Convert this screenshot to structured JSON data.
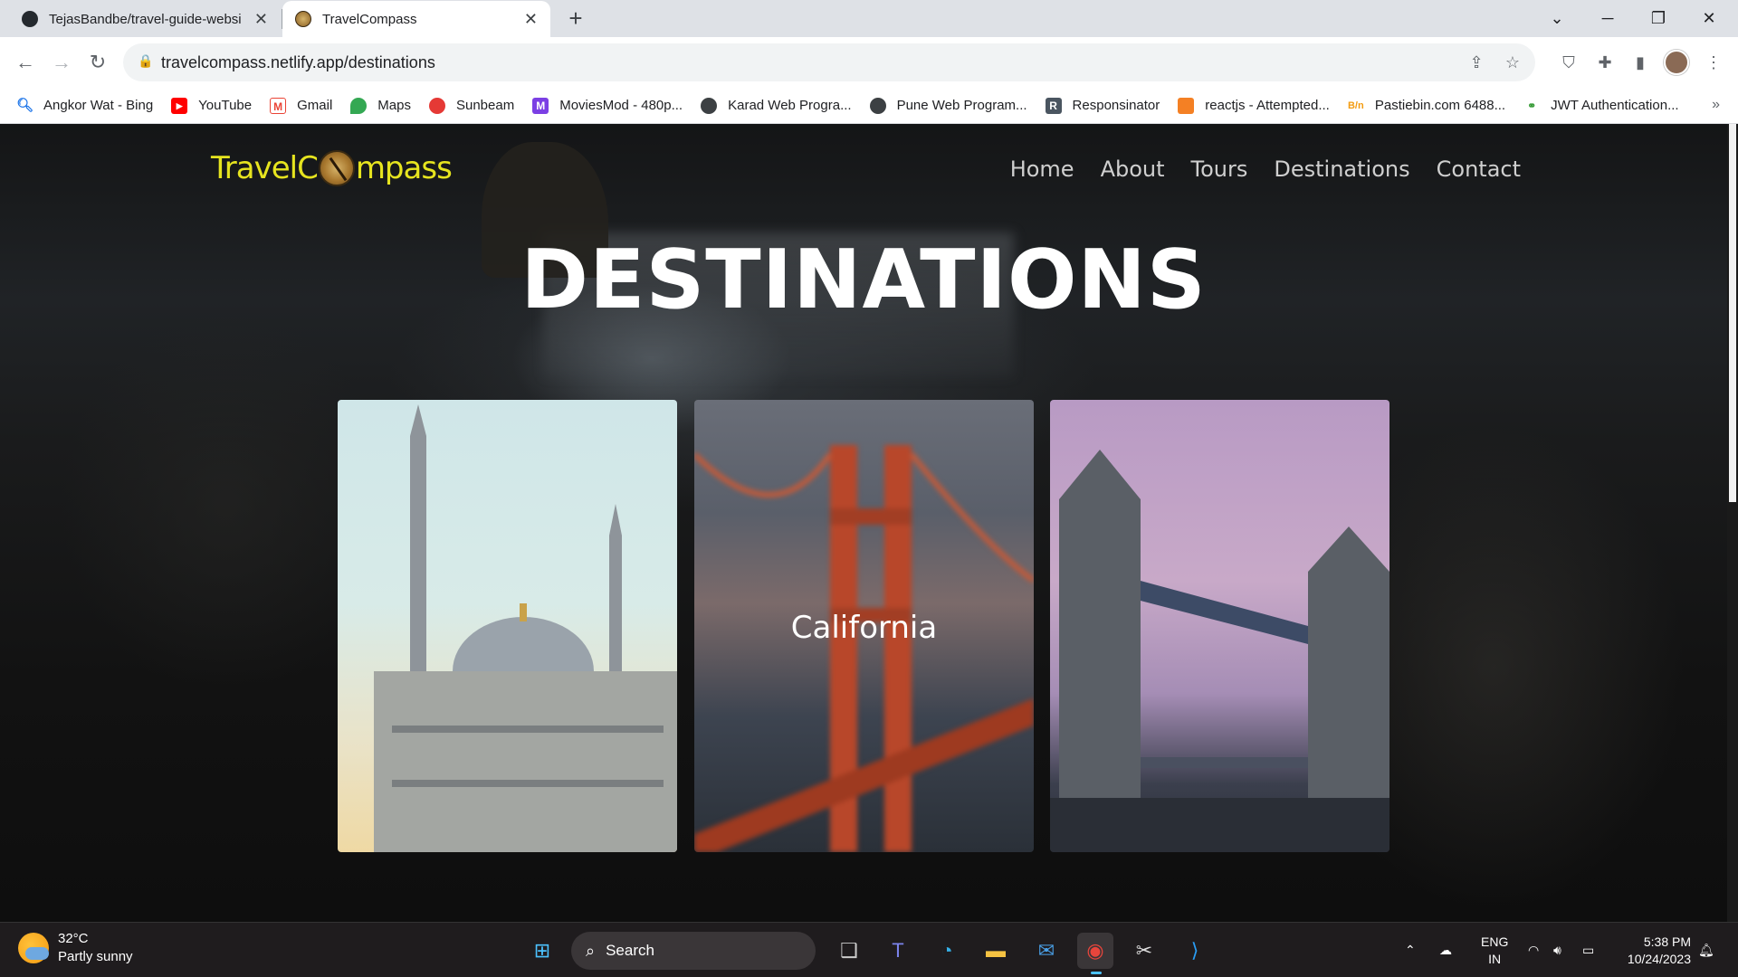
{
  "browser": {
    "tabs": [
      {
        "title": "TejasBandbe/travel-guide-websi"
      },
      {
        "title": "TravelCompass"
      }
    ],
    "url": "travelcompass.netlify.app/destinations",
    "bookmarks": [
      {
        "label": "Angkor Wat - Bing"
      },
      {
        "label": "YouTube"
      },
      {
        "label": "Gmail"
      },
      {
        "label": "Maps"
      },
      {
        "label": "Sunbeam"
      },
      {
        "label": "MoviesMod - 480p..."
      },
      {
        "label": "Karad Web Progra..."
      },
      {
        "label": "Pune Web Program..."
      },
      {
        "label": "Responsinator"
      },
      {
        "label": "reactjs - Attempted..."
      },
      {
        "label": "Pastiebin.com 6488..."
      },
      {
        "label": "JWT Authentication..."
      }
    ],
    "bookmark_more": "»"
  },
  "site": {
    "logo_left": "TravelC",
    "logo_right": "mpass",
    "nav": [
      {
        "label": "Home"
      },
      {
        "label": "About"
      },
      {
        "label": "Tours"
      },
      {
        "label": "Destinations"
      },
      {
        "label": "Contact"
      }
    ],
    "heading": "DESTINATIONS",
    "cards": [
      {
        "label": ""
      },
      {
        "label": "California"
      },
      {
        "label": ""
      }
    ]
  },
  "taskbar": {
    "temperature": "32°C",
    "weather": "Partly sunny",
    "search_label": "Search",
    "lang_top": "ENG",
    "lang_bottom": "IN",
    "time": "5:38 PM",
    "date": "10/24/2023"
  },
  "colors": {
    "logo": "#e6e41f",
    "nav_text": "#cfcfcf",
    "heading": "#ffffff"
  }
}
